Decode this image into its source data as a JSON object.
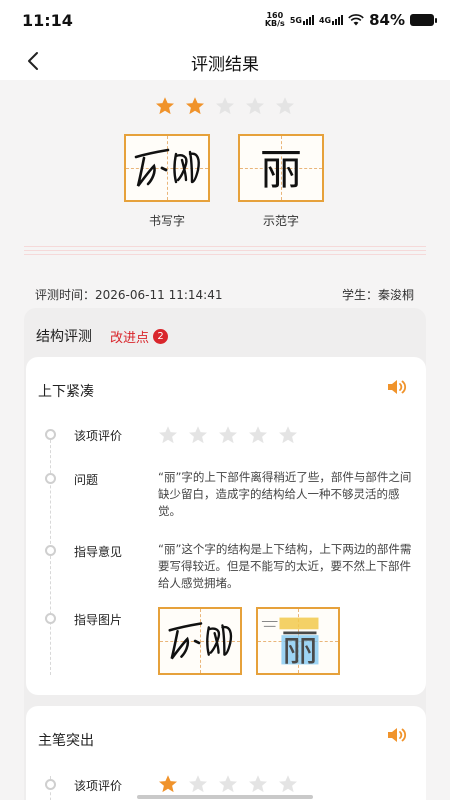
{
  "status_bar": {
    "time": "11:14",
    "net_speed_value": "160",
    "net_speed_unit": "KB/s",
    "signal_1": "5G",
    "signal_2": "4G",
    "battery": "84%"
  },
  "nav": {
    "title": "评测结果",
    "back_icon": "chevron-left-icon"
  },
  "overall_rating": {
    "filled": 2,
    "total": 5
  },
  "written_char_label": "书写字",
  "model_char_label": "示范字",
  "model_char": "丽",
  "meta": {
    "time_label": "评测时间：",
    "time_value": "2026-06-11 11:14:41",
    "student_label": "学生：",
    "student_value": "秦浚桐"
  },
  "panel": {
    "title": "结构评测",
    "improve_label": "改进点",
    "improve_count": "2"
  },
  "cards": [
    {
      "title": "上下紧凑",
      "rating_label": "该项评价",
      "rating": {
        "filled": 0,
        "total": 5
      },
      "problem_label": "问题",
      "problem_text": "“丽”字的上下部件离得稍近了些，部件与部件之间缺少留白，造成字的结构给人一种不够灵活的感觉。",
      "advice_label": "指导意见",
      "advice_text": "“丽”这个字的结构是上下结构，上下两边的部件需要写得较近。但是不能写的太近，要不然上下部件给人感觉拥堵。",
      "image_label": "指导图片",
      "guide_model_char": "丽"
    },
    {
      "title": "主笔突出",
      "rating_label": "该项评价",
      "rating": {
        "filled": 1,
        "total": 5
      }
    }
  ],
  "colors": {
    "star_filled": "#f0932b",
    "star_empty": "#e4e4e4",
    "accent_red": "#d9262c",
    "frame_orange": "#e6a13b"
  }
}
